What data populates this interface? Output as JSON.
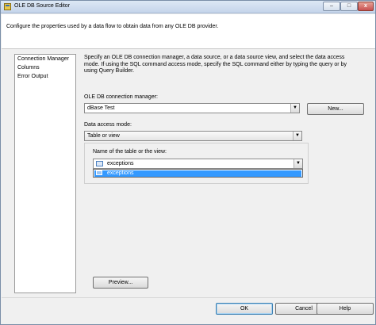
{
  "window": {
    "title": "OLE DB Source Editor",
    "controls": {
      "minimize": "–",
      "maximize": "□",
      "close": "x"
    }
  },
  "header": {
    "description": "Configure the properties used by a data flow to obtain data from any OLE DB provider."
  },
  "nav": {
    "items": [
      {
        "label": "Connection Manager",
        "selected": true
      },
      {
        "label": "Columns",
        "selected": false
      },
      {
        "label": "Error Output",
        "selected": false
      }
    ]
  },
  "main": {
    "instructions": "Specify an OLE DB connection manager, a data source, or a data source view, and select the data access mode. If using the SQL command access mode, specify the SQL command either by typing the query or by using Query Builder.",
    "connection_manager": {
      "label": "OLE DB connection manager:",
      "value": "dBase Test",
      "new_button": "New..."
    },
    "data_access_mode": {
      "label": "Data access mode:",
      "value": "Table or view"
    },
    "table_view": {
      "label": "Name of the table or the view:",
      "value": "exceptions",
      "dropdown_options": [
        "exceptions"
      ]
    },
    "preview_button": "Preview..."
  },
  "footer": {
    "ok": "OK",
    "cancel": "Cancel",
    "help": "Help"
  },
  "colors": {
    "selection": "#3399ff",
    "title_bar": "#c4d4ea"
  }
}
